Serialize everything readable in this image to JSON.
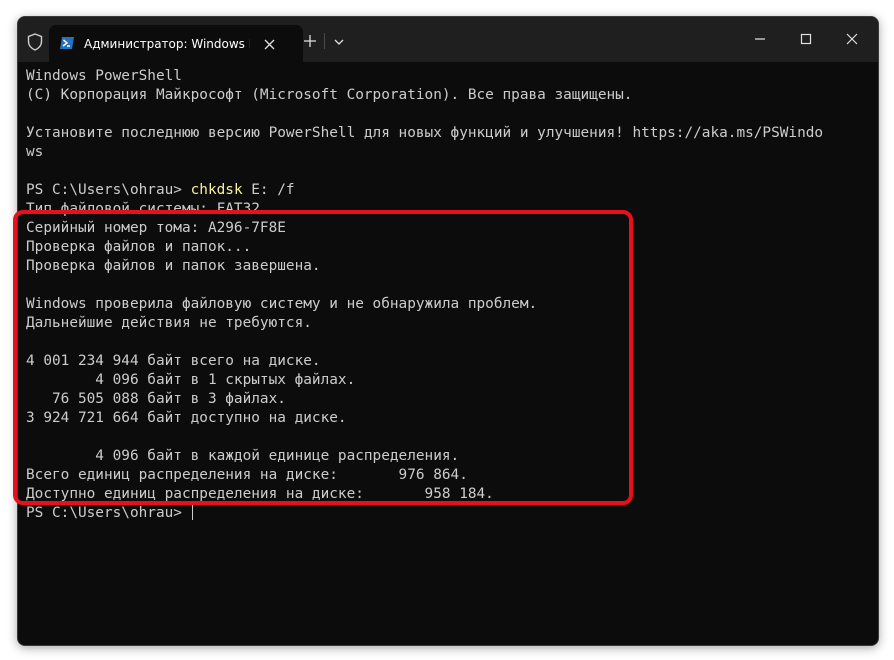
{
  "window": {
    "tab_title": "Администратор: Windows PowerShell",
    "tab_icon": "powershell-icon",
    "icons": {
      "shield": "shield-icon",
      "close_tab": "close-icon",
      "new_tab": "plus-icon",
      "dropdown": "chevron-down-icon",
      "minimize": "minimize-icon",
      "maximize": "maximize-icon",
      "close_window": "close-icon"
    }
  },
  "colors": {
    "terminal_bg": "#0c0c0c",
    "text": "#cccccc",
    "command": "#f9f1a5",
    "highlight_border": "#e8101b"
  },
  "terminal": {
    "lines": {
      "l1": "Windows PowerShell",
      "l2": "(C) Корпорация Майкрософт (Microsoft Corporation). Все права защищены.",
      "l4": "Установите последнюю версию PowerShell для новых функций и улучшения! https://aka.ms/PSWindo",
      "l5": "ws",
      "prompt1": "PS C:\\Users\\ohrau> ",
      "cmd": "chkdsk",
      "cmd_args": " E: /f",
      "l8": "Тип файловой системы: FAT32.",
      "l9": "Серийный номер тома: A296-7F8E",
      "l10": "Проверка файлов и папок...",
      "l11": "Проверка файлов и папок завершена.",
      "l13": "Windows проверила файловую систему и не обнаружила проблем.",
      "l14": "Дальнейшие действия не требуются.",
      "l16": "4 001 234 944 байт всего на диске.",
      "l17": "        4 096 байт в 1 скрытых файлах.",
      "l18": "   76 505 088 байт в 3 файлах.",
      "l19": "3 924 721 664 байт доступно на диске.",
      "l21": "        4 096 байт в каждой единице распределения.",
      "l22": "Всего единиц распределения на диске:       976 864.",
      "l23": "Доступно единиц распределения на диске:       958 184.",
      "prompt2": "PS C:\\Users\\ohrau> "
    }
  }
}
